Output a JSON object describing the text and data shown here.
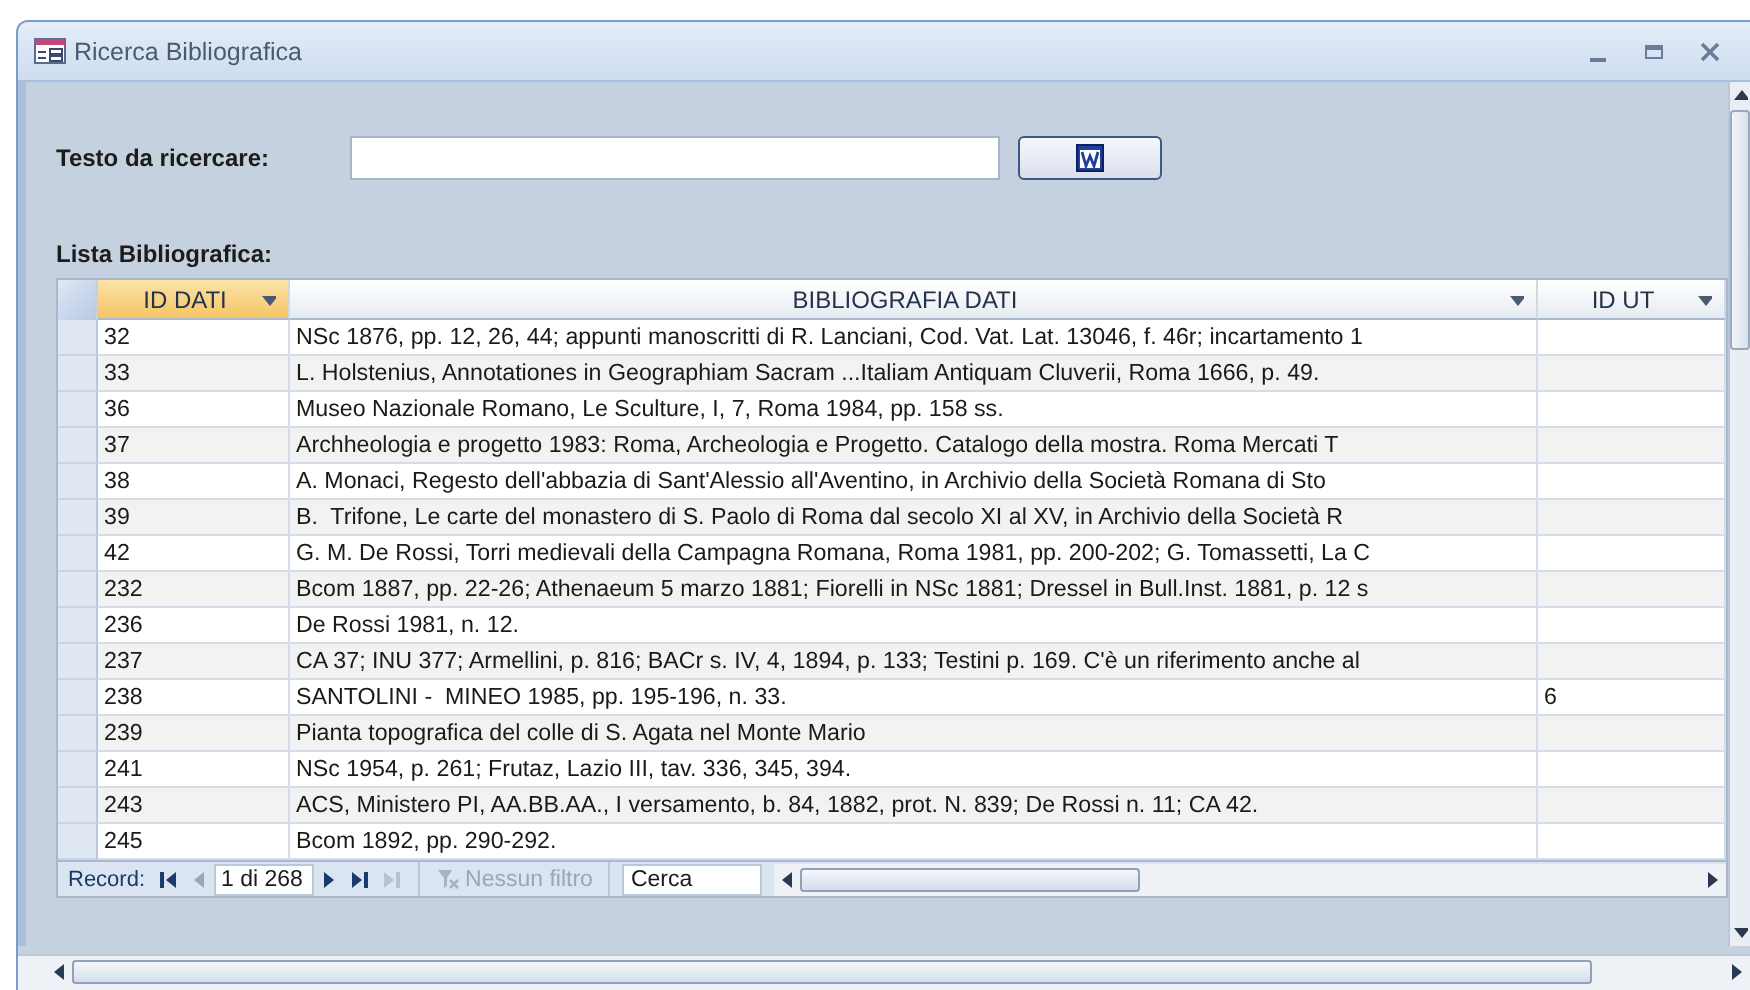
{
  "window": {
    "title": "Ricerca Bibliografica"
  },
  "search": {
    "label": "Testo da ricercare:"
  },
  "list_label": "Lista Bibliografica:",
  "table": {
    "columns": [
      {
        "label": "ID DATI",
        "selected": true
      },
      {
        "label": "BIBLIOGRAFIA DATI",
        "selected": false
      },
      {
        "label": "ID UT",
        "selected": false
      }
    ],
    "rows": [
      {
        "id": "32",
        "bibliografia": "NSc 1876, pp. 12, 26, 44; appunti manoscritti di R. Lanciani, Cod. Vat. Lat. 13046, f. 46r; incartamento 1"
      },
      {
        "id": "33",
        "bibliografia": "L. Holstenius, Annotationes in Geographiam Sacram ...Italiam Antiquam Cluverii, Roma 1666, p. 49."
      },
      {
        "id": "36",
        "bibliografia": "Museo Nazionale Romano, Le Sculture, I, 7, Roma 1984, pp. 158 ss."
      },
      {
        "id": "37",
        "bibliografia": "Archheologia e progetto 1983: Roma, Archeologia e Progetto. Catalogo della mostra. Roma Mercati T"
      },
      {
        "id": "38",
        "bibliografia": "A. Monaci, Regesto dell'abbazia di Sant'Alessio all'Aventino, in Archivio della Società Romana di Sto"
      },
      {
        "id": "39",
        "bibliografia": "B.  Trifone, Le carte del monastero di S. Paolo di Roma dal secolo XI al XV, in Archivio della Società R"
      },
      {
        "id": "42",
        "bibliografia": "G. M. De Rossi, Torri medievali della Campagna Romana, Roma 1981, pp. 200-202; G. Tomassetti, La C"
      },
      {
        "id": "232",
        "bibliografia": "Bcom 1887, pp. 22-26; Athenaeum 5 marzo 1881; Fiorelli in NSc 1881; Dressel in Bull.Inst. 1881, p. 12 s"
      },
      {
        "id": "236",
        "bibliografia": "De Rossi 1981, n. 12."
      },
      {
        "id": "237",
        "bibliografia": "CA 37; INU 377; Armellini, p. 816; BACr s. IV, 4, 1894, p. 133; Testini p. 169. C'è un riferimento anche al"
      },
      {
        "id": "238",
        "bibliografia": "SANTOLINI -  MINEO 1985, pp. 195-196, n. 33.",
        "id_ut": "6"
      },
      {
        "id": "239",
        "bibliografia": "Pianta topografica del colle di S. Agata nel Monte Mario"
      },
      {
        "id": "241",
        "bibliografia": "NSc 1954, p. 261; Frutaz, Lazio III, tav. 336, 345, 394."
      },
      {
        "id": "243",
        "bibliografia": "ACS, Ministero PI, AA.BB.AA., I versamento, b. 84, 1882, prot. N. 839; De Rossi n. 11; CA 42."
      },
      {
        "id": "245",
        "bibliografia": "Bcom 1892, pp. 290-292."
      }
    ]
  },
  "navigation": {
    "label": "Record:",
    "position": "1 di 268",
    "filter": {
      "label": "Nessun filtro",
      "disabled": true
    },
    "search_placeholder": "Cerca"
  }
}
